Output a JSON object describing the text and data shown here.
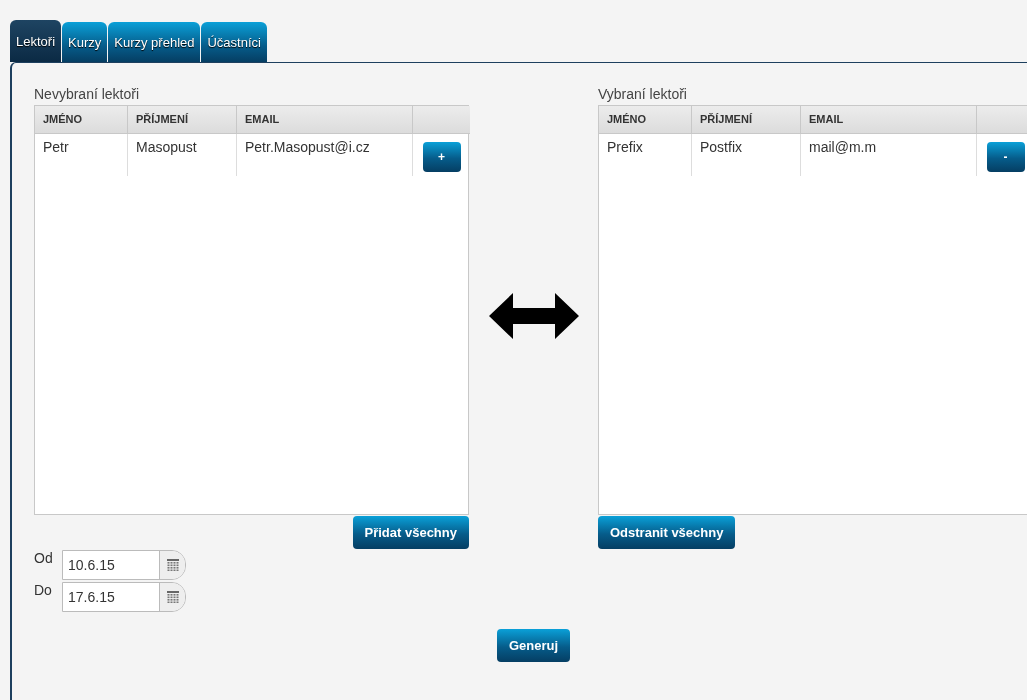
{
  "tabs": [
    {
      "label": "Lektoři",
      "selected": true
    },
    {
      "label": "Kurzy",
      "selected": false
    },
    {
      "label": "Kurzy přehled",
      "selected": false
    },
    {
      "label": "Účastníci",
      "selected": false
    }
  ],
  "unselected_list": {
    "title": "Nevybraní lektoři",
    "columns": [
      "JMÉNO",
      "PŘÍJMENÍ",
      "EMAIL"
    ],
    "rows": [
      {
        "cells": [
          "Petr",
          "Masopust",
          "Petr.Masopust@i.cz"
        ],
        "action": "+"
      }
    ],
    "button": "Přidat všechny"
  },
  "selected_list": {
    "title": "Vybraní lektoři",
    "columns": [
      "JMÉNO",
      "PŘÍJMENÍ",
      "EMAIL"
    ],
    "rows": [
      {
        "cells": [
          "Prefix",
          "Postfix",
          "mail@m.m"
        ],
        "action": "-"
      }
    ],
    "button": "Odstranit všechny"
  },
  "dates": [
    {
      "label": "Od",
      "value": "10.6.15"
    },
    {
      "label": "Do",
      "value": "17.6.15"
    }
  ],
  "generate_button": "Generuj"
}
